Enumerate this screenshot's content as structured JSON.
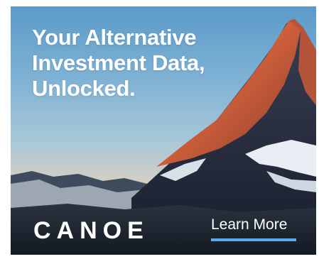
{
  "ad": {
    "headline_lines": [
      "Your Alternative",
      "Investment Data,",
      "Unlocked."
    ],
    "brand": "CANOE",
    "cta_label": "Learn More",
    "colors": {
      "accent_underline": "#5aa9f2",
      "text": "#ffffff",
      "sunlit_peak": "#e0734a"
    }
  }
}
